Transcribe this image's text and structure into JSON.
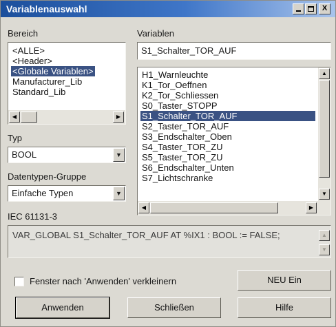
{
  "window": {
    "title": "Variablenauswahl",
    "minimize_glyph": "_",
    "maximize_glyph": "□",
    "close_glyph": "X"
  },
  "bereich": {
    "label": "Bereich",
    "items": [
      "<ALLE>",
      "<Header>",
      "<Globale Variablen>",
      "Manufacturer_Lib",
      "Standard_Lib"
    ],
    "selected_index": 2
  },
  "variablen": {
    "label": "Variablen",
    "input_value": "S1_Schalter_TOR_AUF",
    "items": [
      "H1_Warnleuchte",
      "K1_Tor_Oeffnen",
      "K2_Tor_Schliessen",
      "S0_Taster_STOPP",
      "S1_Schalter_TOR_AUF",
      "S2_Taster_TOR_AUF",
      "S3_Endschalter_Oben",
      "S4_Taster_TOR_ZU",
      "S5_Taster_TOR_ZU",
      "S6_Endschalter_Unten",
      "S7_Lichtschranke"
    ],
    "selected_index": 4
  },
  "typ": {
    "label": "Typ",
    "value": "BOOL"
  },
  "datentypen_gruppe": {
    "label": "Datentypen-Gruppe",
    "value": "Einfache Typen"
  },
  "iec": {
    "label": "IEC 61131-3",
    "declaration": "VAR_GLOBAL S1_Schalter_TOR_AUF AT %IX1 : BOOL := FALSE;"
  },
  "options": {
    "shrink_checkbox_label": "Fenster nach 'Anwenden' verkleinern",
    "shrink_checked": false
  },
  "buttons": {
    "neu_ein": "NEU Ein",
    "anwenden": "Anwenden",
    "schliessen": "Schließen",
    "hilfe": "Hilfe"
  },
  "icons": {
    "arrow_left": "◀",
    "arrow_right": "▶",
    "arrow_up": "▲",
    "arrow_down": "▼"
  }
}
